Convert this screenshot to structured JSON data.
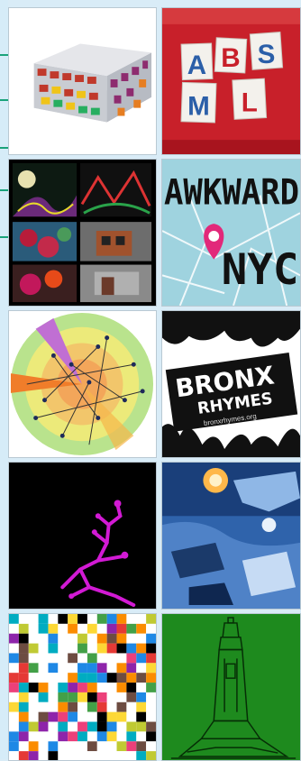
{
  "tiles": [
    {
      "name": "building-model",
      "alt": ""
    },
    {
      "name": "absml-letters",
      "alt": "",
      "letters": [
        "A",
        "B",
        "S",
        "M",
        "L"
      ]
    },
    {
      "name": "3d-renders-collage",
      "alt": ""
    },
    {
      "name": "awkward-nyc",
      "alt": "",
      "line1": "AWKWARD",
      "line2": "NYC"
    },
    {
      "name": "radial-network-chart",
      "alt": ""
    },
    {
      "name": "bronx-rhymes",
      "alt": "",
      "line1": "BRONX",
      "line2": "RHYMES",
      "url": "bronxrhymes.org"
    },
    {
      "name": "magenta-tree",
      "alt": ""
    },
    {
      "name": "blue-debris-photo",
      "alt": ""
    },
    {
      "name": "color-pixel-mosaic",
      "alt": ""
    },
    {
      "name": "green-tower-drawing",
      "alt": ""
    }
  ],
  "colors": {
    "background": "#d9ecf7",
    "rail_tick": "#1aa37a",
    "absml_red": "#c8202a",
    "awkward_blue": "#9fd3df",
    "pin_pink": "#e2287a",
    "magenta": "#d21ad4",
    "tower_green": "#1e8a1e"
  }
}
